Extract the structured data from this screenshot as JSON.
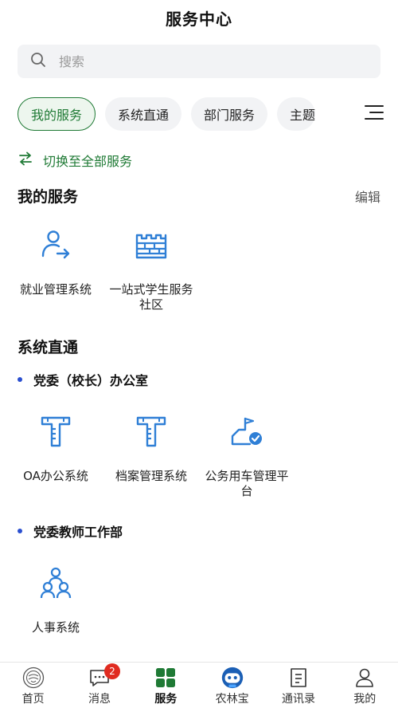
{
  "header": {
    "title": "服务中心"
  },
  "search": {
    "placeholder": "搜索"
  },
  "tabs": [
    {
      "label": "我的服务",
      "active": true
    },
    {
      "label": "系统直通",
      "active": false
    },
    {
      "label": "部门服务",
      "active": false
    },
    {
      "label": "主题",
      "active": false
    }
  ],
  "switch_all": {
    "label": "切换至全部服务"
  },
  "my_services": {
    "title": "我的服务",
    "edit_label": "编辑",
    "items": [
      {
        "label": "就业管理系统",
        "icon": "user-arrow-icon"
      },
      {
        "label": "一站式学生服务社区",
        "icon": "castle-wall-icon"
      }
    ]
  },
  "system_direct": {
    "title": "系统直通",
    "groups": [
      {
        "name": "党委（校长）办公室",
        "items": [
          {
            "label": "OA办公系统",
            "icon": "ruler-t-icon"
          },
          {
            "label": "档案管理系统",
            "icon": "ruler-t-icon"
          },
          {
            "label": "公务用车管理平台",
            "icon": "flag-check-icon"
          }
        ]
      },
      {
        "name": "党委教师工作部",
        "items": [
          {
            "label": "人事系统",
            "icon": "people-group-icon"
          }
        ]
      }
    ]
  },
  "tabbar": [
    {
      "label": "首页",
      "icon": "school-logo-icon"
    },
    {
      "label": "消息",
      "icon": "message-icon",
      "badge": "2"
    },
    {
      "label": "服务",
      "icon": "grid-icon",
      "active": true
    },
    {
      "label": "农林宝",
      "icon": "robot-icon"
    },
    {
      "label": "通讯录",
      "icon": "contacts-icon"
    },
    {
      "label": "我的",
      "icon": "person-icon"
    }
  ],
  "colors": {
    "accent_green": "#1f7a35",
    "icon_blue": "#2f7fd6",
    "badge_red": "#e02b20"
  }
}
